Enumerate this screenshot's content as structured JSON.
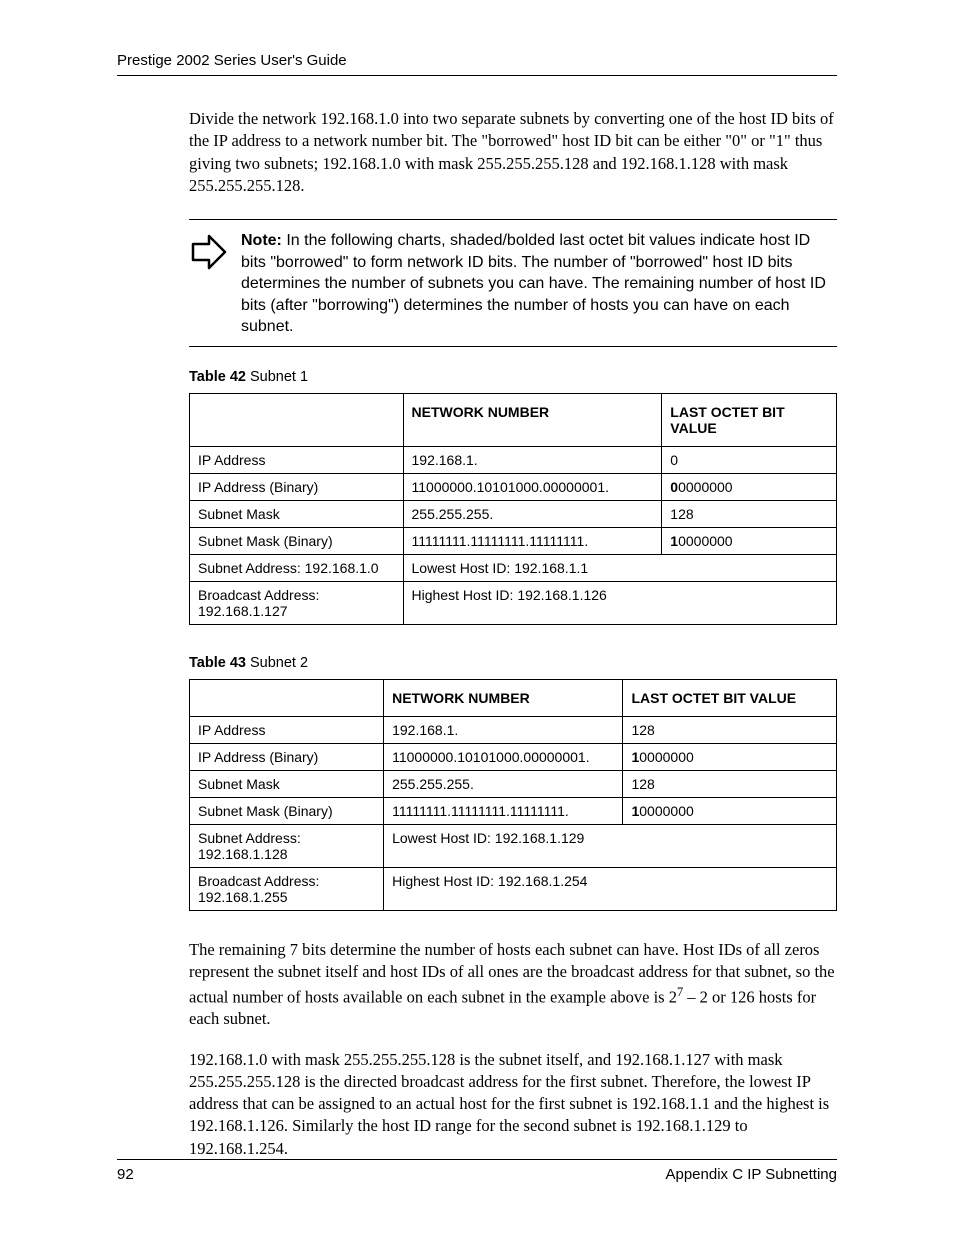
{
  "header": {
    "running_head": "Prestige 2002 Series User's Guide"
  },
  "para1": "Divide the network 192.168.1.0 into two separate subnets by converting one of the host ID bits of the IP address to a network number bit. The \"borrowed\" host ID bit can be either \"0\" or \"1\" thus giving two subnets; 192.168.1.0 with mask 255.255.255.128 and 192.168.1.128 with mask 255.255.255.128.",
  "note": {
    "label": "Note:",
    "text": " In the following charts, shaded/bolded last octet bit values indicate host ID bits \"borrowed\" to form network ID bits. The number of \"borrowed\" host ID bits determines the number of subnets you can have. The remaining number of host ID bits  (after \"borrowing\") determines the number of hosts you can have on each subnet."
  },
  "table42": {
    "caption_label": "Table 42",
    "caption_title": "   Subnet 1",
    "head_blank": "",
    "head_col2": "NETWORK NUMBER",
    "head_col3": "LAST OCTET BIT VALUE",
    "rows": [
      {
        "c1": "IP Address",
        "c2": "192.168.1.",
        "c3_pre": "",
        "c3_bold": "",
        "c3_post": "0"
      },
      {
        "c1": "IP Address (Binary)",
        "c2": "11000000.10101000.00000001.",
        "c3_pre": "",
        "c3_bold": "0",
        "c3_post": "0000000"
      },
      {
        "c1": "Subnet Mask",
        "c2": "255.255.255.",
        "c3_pre": "",
        "c3_bold": "",
        "c3_post": "128"
      },
      {
        "c1": "Subnet Mask (Binary)",
        "c2": "11111111.11111111.11111111.",
        "c3_pre": "",
        "c3_bold": "1",
        "c3_post": "0000000"
      }
    ],
    "span_rows": [
      {
        "c1": "Subnet Address: 192.168.1.0",
        "c2": "Lowest Host ID: 192.168.1.1"
      },
      {
        "c1": "Broadcast Address: 192.168.1.127",
        "c2": "Highest Host ID: 192.168.1.126"
      }
    ]
  },
  "table43": {
    "caption_label": "Table 43",
    "caption_title": "   Subnet 2",
    "head_blank": "",
    "head_col2": "NETWORK NUMBER",
    "head_col3": "LAST OCTET BIT VALUE",
    "rows": [
      {
        "c1": "IP Address",
        "c2": "192.168.1.",
        "c3_pre": "",
        "c3_bold": "",
        "c3_post": "128"
      },
      {
        "c1": "IP Address (Binary)",
        "c2": "11000000.10101000.00000001.",
        "c3_pre": "",
        "c3_bold": "1",
        "c3_post": "0000000"
      },
      {
        "c1": "Subnet Mask",
        "c2": "255.255.255.",
        "c3_pre": "",
        "c3_bold": "",
        "c3_post": "128"
      },
      {
        "c1": "Subnet Mask (Binary)",
        "c2": "11111111.11111111.11111111.",
        "c3_pre": "",
        "c3_bold": "1",
        "c3_post": "0000000"
      }
    ],
    "span_rows": [
      {
        "c1": "Subnet Address: 192.168.1.128",
        "c2": "Lowest Host ID: 192.168.1.129"
      },
      {
        "c1": "Broadcast Address: 192.168.1.255",
        "c2": "Highest Host ID: 192.168.1.254"
      }
    ]
  },
  "para2_a": "The remaining 7 bits determine the number of hosts each subnet can have. Host IDs of all zeros represent the subnet itself and host IDs of all ones are the broadcast address for that subnet, so the actual number of hosts available on each subnet in the example above is 2",
  "para2_sup": "7",
  "para2_b": " – 2 or 126 hosts for each subnet.",
  "para3": "192.168.1.0 with mask 255.255.255.128 is the subnet itself, and 192.168.1.127 with mask 255.255.255.128 is the directed broadcast address for the first subnet. Therefore, the lowest IP address that can be assigned to an actual host for the first subnet is 192.168.1.1 and the highest is 192.168.1.126. Similarly the host ID range for the second subnet is 192.168.1.129 to 192.168.1.254.",
  "footer": {
    "page_no": "92",
    "section": "Appendix C IP Subnetting"
  }
}
